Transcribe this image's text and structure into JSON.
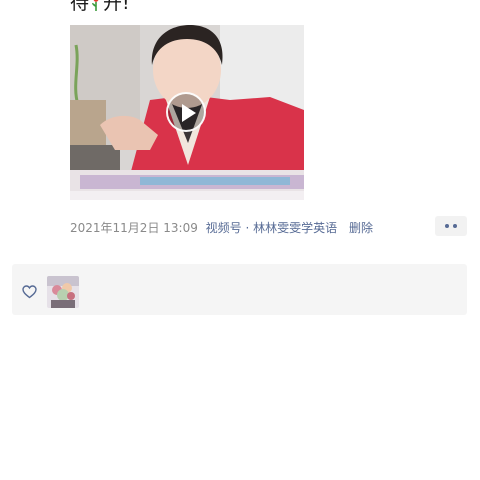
{
  "post": {
    "text_start": "待",
    "text_end": "开!",
    "inline_emoji": "flower-emoji"
  },
  "video": {
    "play_icon": "play-icon"
  },
  "meta": {
    "timestamp": "2021年11月2日 13:09",
    "source": "视频号 · 林林雯雯学英语",
    "delete_label": "删除"
  },
  "actions": {
    "more_icon": "more-dots-icon"
  },
  "likes": {
    "heart_icon": "heart-outline-icon",
    "avatar_icon": "user-avatar"
  },
  "colors": {
    "link": "#576b95",
    "meta_gray": "#8a8a8a",
    "panel_bg": "#f5f5f5"
  }
}
